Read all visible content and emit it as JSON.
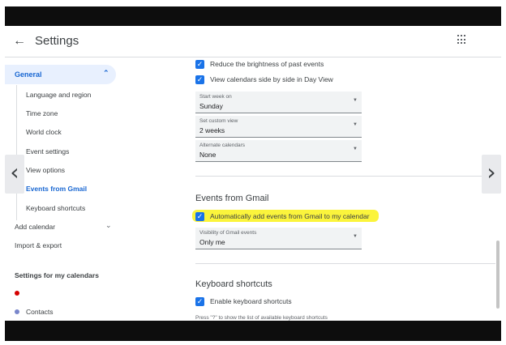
{
  "header": {
    "back_icon": "arrow-back-icon",
    "title": "Settings",
    "apps_icon": "apps-grid-icon"
  },
  "sidebar": {
    "general": {
      "label": "General",
      "expanded": true
    },
    "general_items": [
      {
        "label": "Language and region"
      },
      {
        "label": "Time zone"
      },
      {
        "label": "World clock"
      },
      {
        "label": "Event settings"
      },
      {
        "label": "View options"
      },
      {
        "label": "Events from Gmail",
        "active": true
      },
      {
        "label": "Keyboard shortcuts"
      }
    ],
    "add_calendar": "Add calendar",
    "import_export": "Import & export",
    "my_calendars_header": "Settings for my calendars",
    "calendars": [
      {
        "label": "",
        "color": "#d50000"
      },
      {
        "label": "Contacts",
        "color": "#7986cb"
      }
    ]
  },
  "view_options": {
    "reduce_brightness": {
      "label": "Reduce the brightness of past events",
      "checked": true
    },
    "side_by_side": {
      "label": "View calendars side by side in Day View",
      "checked": true
    },
    "start_week": {
      "caption": "Start week on",
      "value": "Sunday"
    },
    "custom_view": {
      "caption": "Set custom view",
      "value": "2 weeks"
    },
    "alternate": {
      "caption": "Alternate calendars",
      "value": "None"
    }
  },
  "gmail": {
    "title": "Events from Gmail",
    "auto_add": {
      "label": "Automatically add events from Gmail to my calendar",
      "checked": true
    },
    "visibility": {
      "caption": "Visibility of Gmail events",
      "value": "Only me"
    }
  },
  "keyboard": {
    "title": "Keyboard shortcuts",
    "enable": {
      "label": "Enable keyboard shortcuts",
      "checked": true
    },
    "hint": "Press \"?\" to show the list of available keyboard shortcuts"
  },
  "nav": {
    "prev_icon": "chevron-left-icon",
    "next_icon": "chevron-right-icon"
  },
  "colors": {
    "accent": "#1a73e8",
    "highlight": "#fbf43c"
  }
}
